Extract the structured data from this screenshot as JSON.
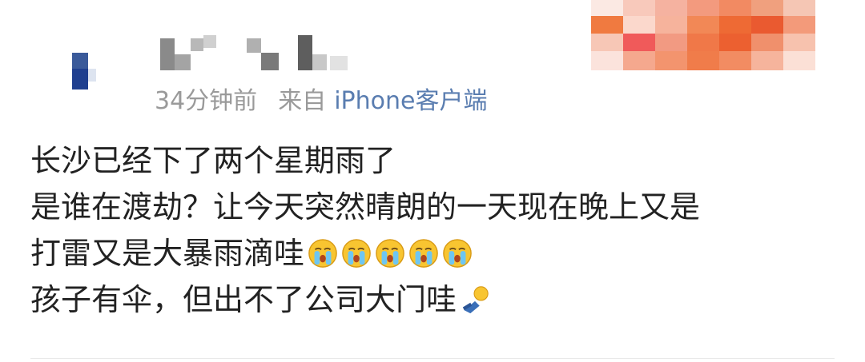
{
  "post": {
    "meta": {
      "time": "34分钟前",
      "from_label": "来自",
      "client": "iPhone客户端"
    },
    "lines": [
      "长沙已经下了两个星期雨了",
      "是谁在渡劫？让今天突然晴朗的一天现在晚上又是",
      "打雷又是大暴雨滴哇",
      "孩子有伞，但出不了公司大门哇"
    ],
    "line3_emojis": [
      "crying-face-icon",
      "crying-face-icon",
      "crying-face-icon",
      "crying-face-icon",
      "crying-face-icon"
    ],
    "line4_emoji": "fallen-person-icon"
  },
  "colors": {
    "text": "#222222",
    "meta_text": "#9a9a9a",
    "client_link": "#5a7db0"
  }
}
